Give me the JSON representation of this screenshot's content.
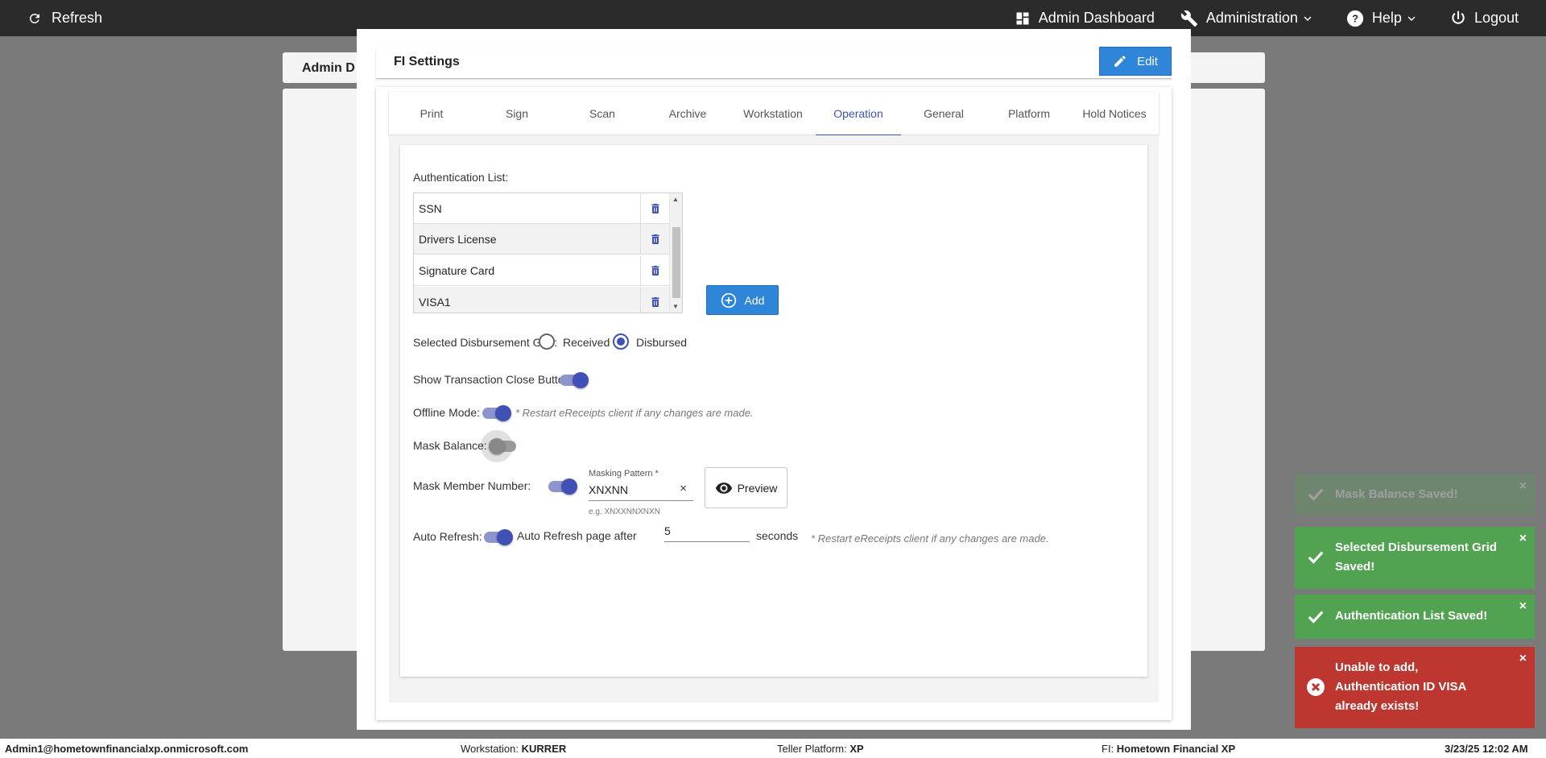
{
  "topbar": {
    "refresh_label": "Refresh",
    "admin_dashboard_label": "Admin Dashboard",
    "administration_label": "Administration",
    "help_label": "Help",
    "logout_label": "Logout"
  },
  "background_page": {
    "card_title": "Admin D"
  },
  "modal": {
    "title": "FI Settings",
    "edit_label": "Edit",
    "tabs": [
      "Print",
      "Sign",
      "Scan",
      "Archive",
      "Workstation",
      "Operation",
      "General",
      "Platform",
      "Hold Notices"
    ],
    "active_tab": "Operation"
  },
  "operation": {
    "auth_list_label": "Authentication List:",
    "auth_items": [
      "SSN",
      "Drivers License",
      "Signature Card",
      "VISA1"
    ],
    "add_label": "Add",
    "disbursement_label": "Selected Disbursement Grid:",
    "received_label": "Received",
    "disbursed_label": "Disbursed",
    "selected_grid": "Disbursed",
    "show_close_label": "Show Transaction Close Button:",
    "show_close_on": true,
    "offline_label": "Offline Mode:",
    "offline_on": true,
    "offline_note": "* Restart eReceipts client if any changes are made.",
    "mask_balance_label": "Mask Balance:",
    "mask_balance_on": false,
    "mask_member_label": "Mask Member Number:",
    "mask_member_on": true,
    "masking_pattern_label": "Masking Pattern *",
    "masking_pattern_value": "XNXNN",
    "masking_pattern_hint": "e.g. XNXXNNXNXN",
    "clear_symbol": "×",
    "preview_label": "Preview",
    "auto_refresh_label": "Auto Refresh:",
    "auto_refresh_on": true,
    "auto_refresh_prefix": "Auto Refresh page after",
    "auto_refresh_value": "5",
    "auto_refresh_suffix": "seconds",
    "auto_refresh_note": "* Restart eReceipts client if any changes are made."
  },
  "footer": {
    "user": "Admin1@hometownfinancialxp.onmicrosoft.com",
    "workstation_label": "Workstation:",
    "workstation_value": "KURRER",
    "teller_label": "Teller Platform:",
    "teller_value": "XP",
    "fi_label": "FI:",
    "fi_value": "Hometown Financial XP",
    "datetime": "3/23/25 12:02 AM"
  },
  "toasts": {
    "mask_balance": "Mask Balance Saved!",
    "disbursement_line1": "Selected Disbursement Grid",
    "disbursement_line2": "Saved!",
    "auth_list": "Authentication List Saved!",
    "error_line1": "Unable to add,",
    "error_line2": "Authentication ID VISA",
    "error_line3": "already exists!",
    "close_symbol": "×"
  },
  "colors": {
    "accent": "#3f51b5",
    "primary_button": "#2f86d8",
    "toast_success": "#51a351",
    "toast_error": "#bd362f",
    "topbar": "#2b2b2b"
  }
}
